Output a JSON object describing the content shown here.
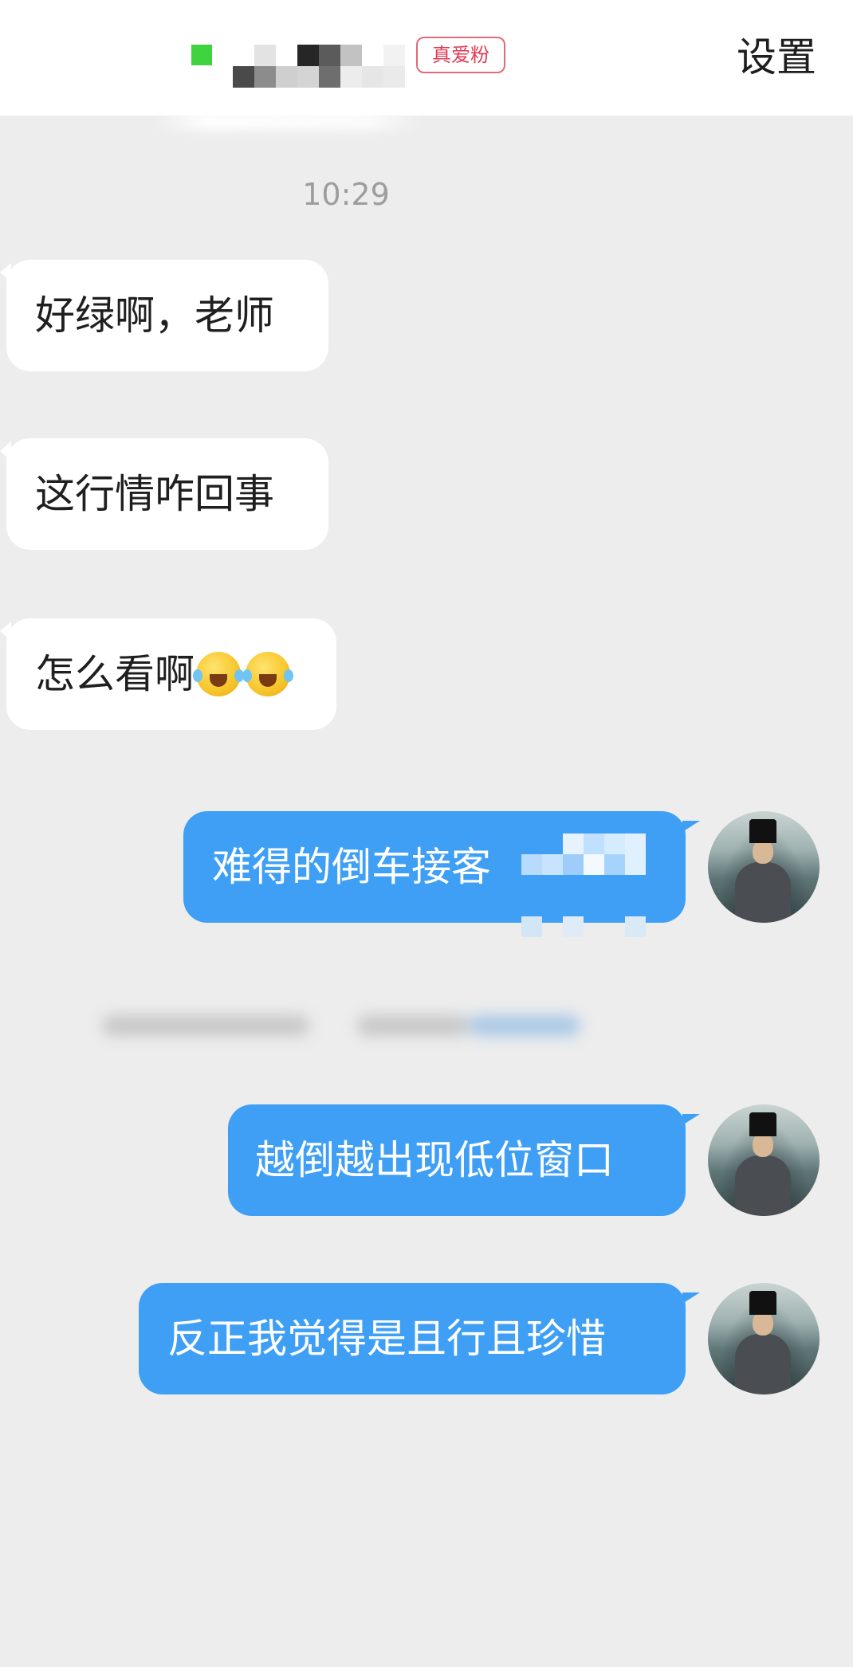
{
  "header": {
    "badge": "真爱粉",
    "settings": "设置"
  },
  "chat": {
    "timestamp": "10:29",
    "messages": [
      {
        "side": "incoming",
        "text": "好绿啊，老师"
      },
      {
        "side": "incoming",
        "text": "这行情咋回事"
      },
      {
        "side": "incoming",
        "text": "怎么看啊",
        "emoji": [
          "crying-laughing-emoji",
          "crying-laughing-emoji"
        ]
      },
      {
        "side": "outgoing",
        "text": "难得的倒车接客"
      },
      {
        "side": "outgoing",
        "text": "越倒越出现低位窗口"
      },
      {
        "side": "outgoing",
        "text": "反正我觉得是且行且珍惜"
      }
    ]
  },
  "colors": {
    "background": "#ededed",
    "outgoing_bubble": "#3f9ff5",
    "incoming_bubble": "#ffffff",
    "online": "#3fd33f",
    "badge": "#e03a52"
  }
}
